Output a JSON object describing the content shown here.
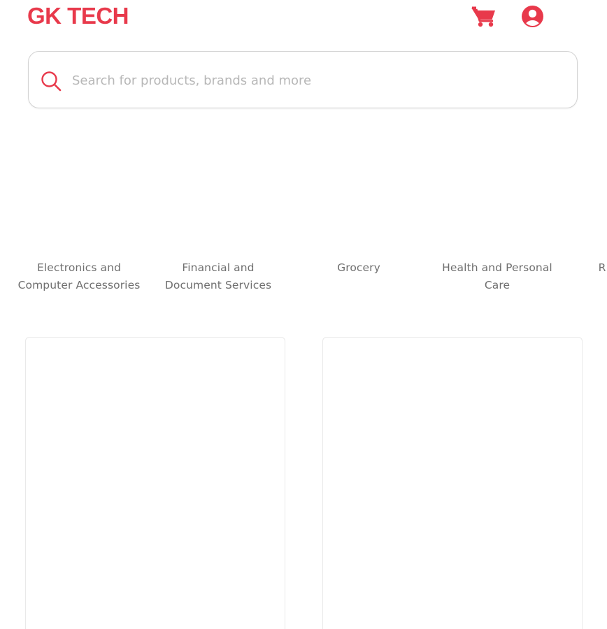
{
  "header": {
    "brand": "GK TECH",
    "cart_icon": "cart-icon",
    "account_icon": "account-icon",
    "accent_color": "#e8394b"
  },
  "search": {
    "placeholder": "Search for products, brands and more",
    "value": "",
    "icon": "search-icon"
  },
  "categories": [
    {
      "label": "Electronics and Computer Accessories"
    },
    {
      "label": "Financial and Document Services"
    },
    {
      "label": "Grocery"
    },
    {
      "label": "Health and Personal Care"
    },
    {
      "label": "R"
    }
  ]
}
